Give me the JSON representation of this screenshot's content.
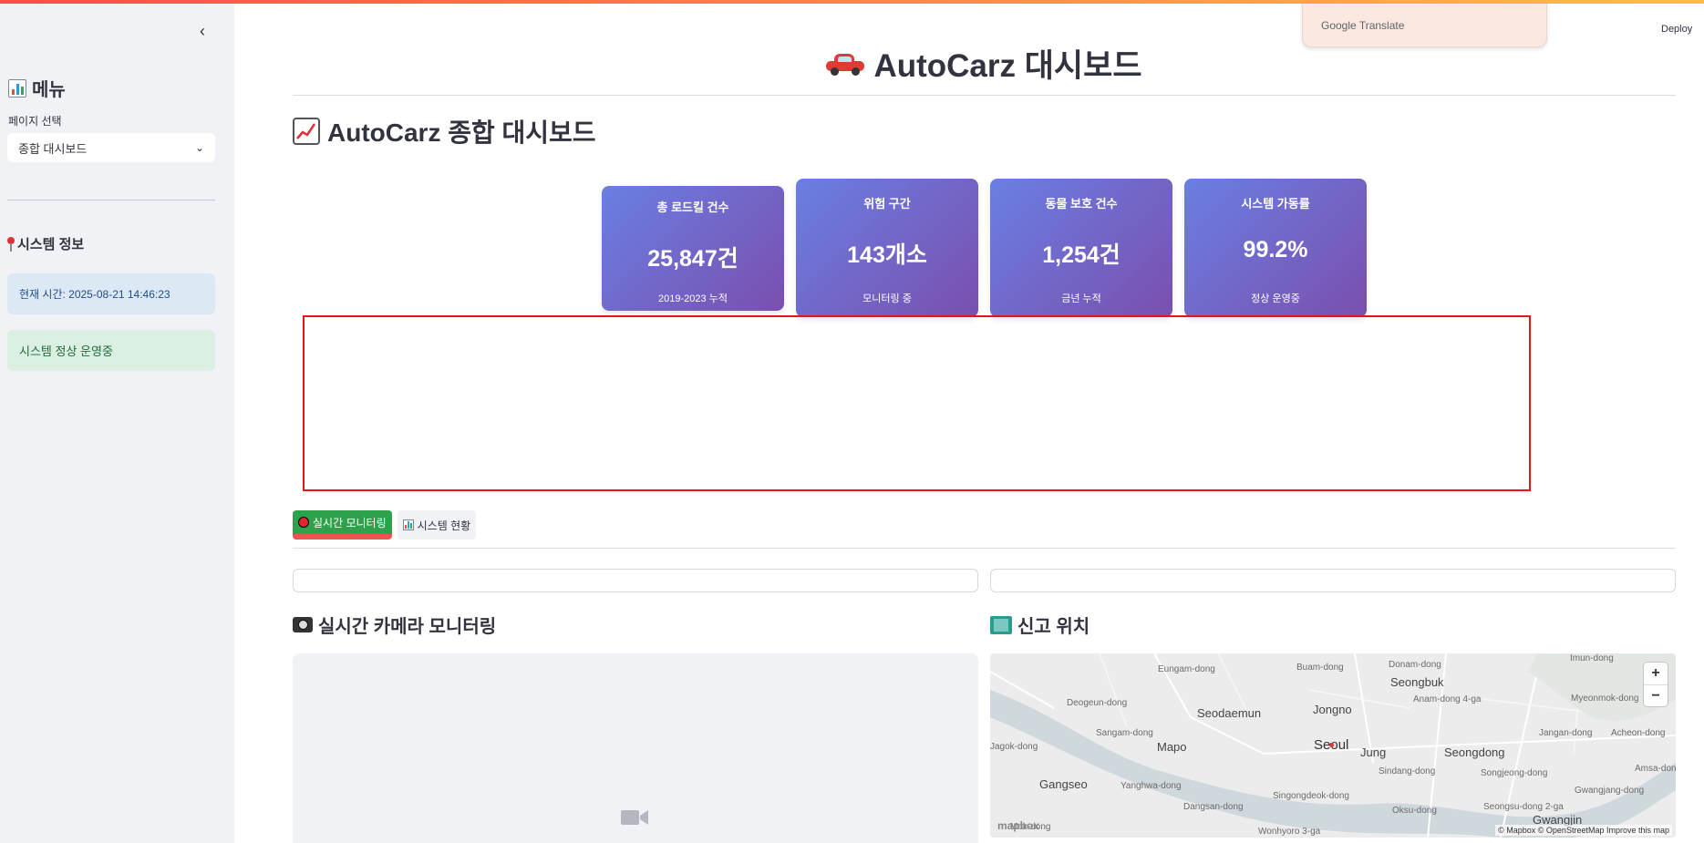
{
  "sidebar": {
    "collapse_icon": "chevron-left-icon",
    "menu_title": "메뉴",
    "select_label": "페이지 선택",
    "select_value": "종합 대시보드",
    "system_info_title": "시스템 정보",
    "current_time": "현재 시간: 2025-08-21 14:46:23",
    "status_message": "시스템 정상 운영중"
  },
  "translate_popup": {
    "label": "Google Translate"
  },
  "header": {
    "deploy_label": "Deploy"
  },
  "main": {
    "title": "AutoCarz 대시보드",
    "subtitle": "AutoCarz 종합 대시보드",
    "cards": [
      {
        "title": "총 로드킬 건수",
        "value": "25,847건",
        "sub": "2019-2023 누적"
      },
      {
        "title": "위험 구간",
        "value": "143개소",
        "sub": "모니터링 중"
      },
      {
        "title": "동물 보호 건수",
        "value": "1,254건",
        "sub": "금년 누적"
      },
      {
        "title": "시스템 가동률",
        "value": "99.2%",
        "sub": "정상 운영중"
      }
    ],
    "tabs": [
      {
        "label": "실시간 모니터링",
        "active": true
      },
      {
        "label": "시스템 현황",
        "active": false
      }
    ],
    "camera_section_title": "실시간 카메라 모니터링",
    "map_section_title": "신고 위치"
  },
  "map": {
    "labels": [
      "Donam-dong",
      "Eungam-dong",
      "Buam-dong",
      "Seongbuk",
      "Deogeun-dong",
      "Seodaemun",
      "Jongno",
      "Anam-dong 4-ga",
      "Myeonmok-dong",
      "Sangam-dong",
      "Mapo",
      "Seoul",
      "Jung",
      "Seongdong",
      "Jangan-dong",
      "Acheon-dong",
      "Gangseo",
      "Yanghwa-dong",
      "Sindang-dong",
      "Songjeong-dong",
      "Amsa-dong",
      "Dangsan-dong",
      "Singongdeok-dong",
      "Oksu-dong",
      "Gwangjang-dong",
      "Mok-dong",
      "Wonhyoro 3-ga",
      "Seongsu-dong 2-ga",
      "Gwangjin",
      "Jagok-dong",
      "Imun-dong"
    ],
    "zoom_in": "+",
    "zoom_out": "−",
    "logo": "mapbox",
    "attribution": "© Mapbox © OpenStreetMap  Improve this map"
  }
}
